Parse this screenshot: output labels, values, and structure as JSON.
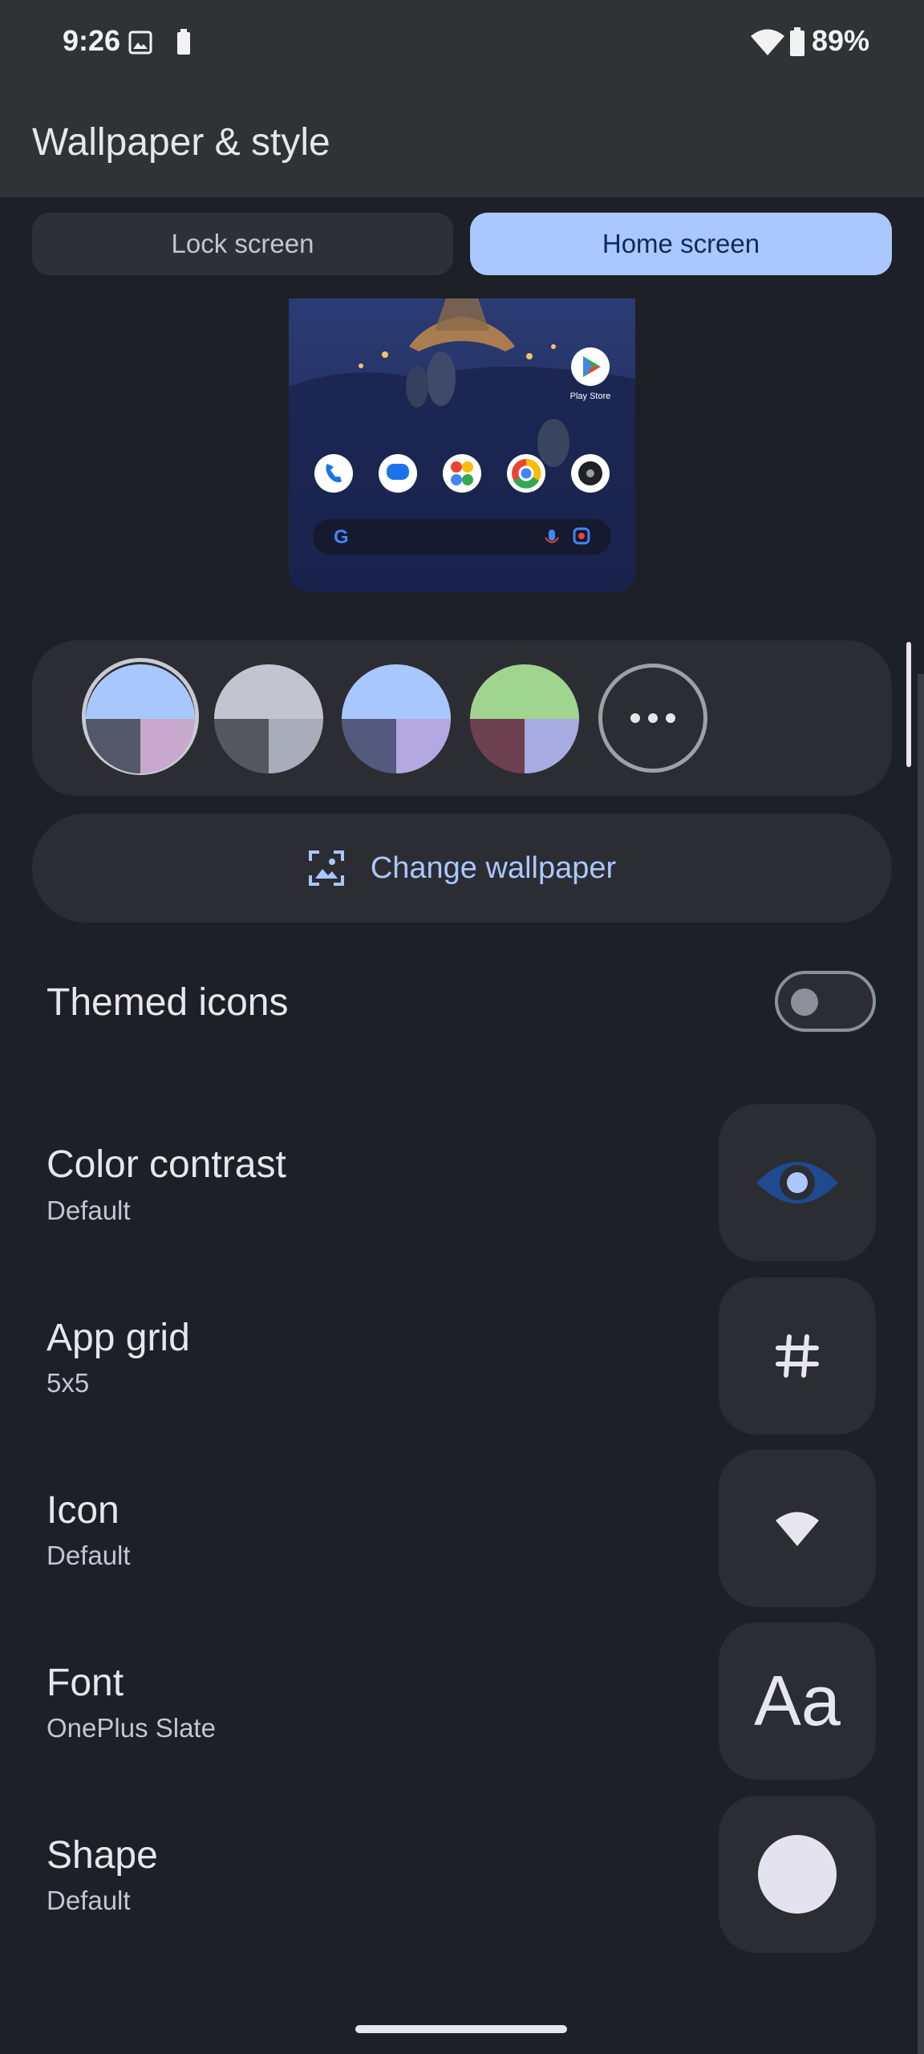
{
  "status_bar": {
    "time": "9:26",
    "battery_percent": "89%"
  },
  "header": {
    "title": "Wallpaper & style"
  },
  "tabs": [
    {
      "label": "Lock screen",
      "selected": false
    },
    {
      "label": "Home screen",
      "selected": true
    }
  ],
  "preview": {
    "play_store_label": "Play Store",
    "search_logo": "G"
  },
  "color_options": [
    {
      "colors": [
        "#a9c7ff",
        "#53576a",
        "#c8a8cc"
      ],
      "selected": true
    },
    {
      "colors": [
        "#c2c4cf",
        "#55575f",
        "#a9adbb"
      ],
      "selected": false
    },
    {
      "colors": [
        "#a9c7ff",
        "#535a7d",
        "#b3a9e0"
      ],
      "selected": false
    },
    {
      "colors": [
        "#9fd58f",
        "#6e4150",
        "#a7abdf"
      ],
      "selected": false
    }
  ],
  "change_wallpaper": {
    "label": "Change wallpaper"
  },
  "settings": {
    "themed_icons": {
      "title": "Themed icons",
      "enabled": false
    },
    "color_contrast": {
      "title": "Color contrast",
      "value": "Default"
    },
    "app_grid": {
      "title": "App grid",
      "value": "5x5"
    },
    "icon": {
      "title": "Icon",
      "value": "Default"
    },
    "font": {
      "title": "Font",
      "value": "OnePlus Slate",
      "preview": "Aa"
    },
    "shape": {
      "title": "Shape",
      "value": "Default"
    }
  },
  "colors": {
    "accent": "#aac7ff",
    "background": "#1e2027",
    "surface": "#2b2d33",
    "topbar": "#303236"
  }
}
